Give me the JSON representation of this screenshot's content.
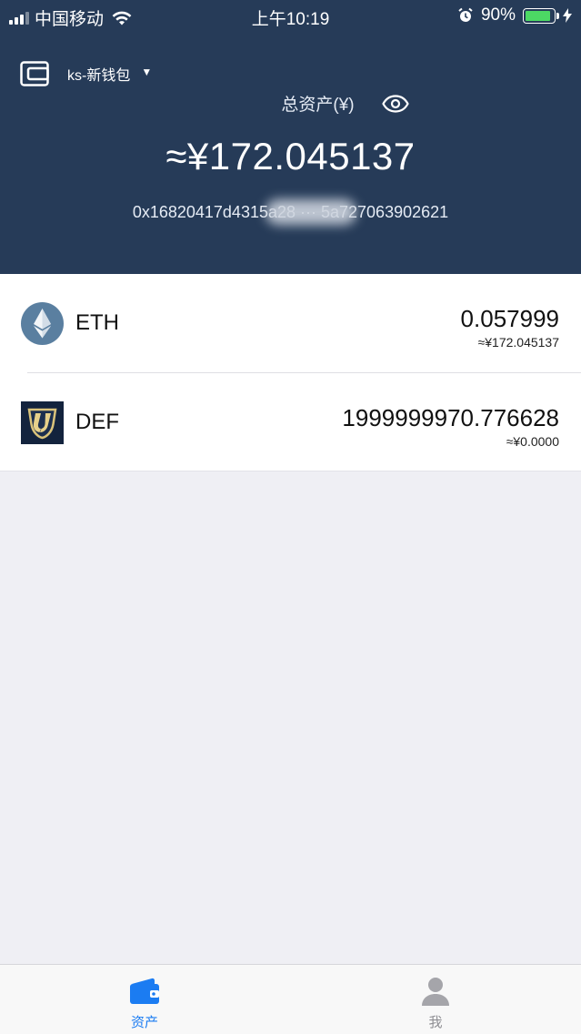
{
  "status_bar": {
    "carrier": "中国移动",
    "time": "上午10:19",
    "battery": "90%",
    "battery_level": 0.9
  },
  "header": {
    "wallet_name": "ks-新钱包",
    "total_label": "总资产(¥)",
    "total_value": "≈¥172.045137",
    "address": "0x16820417d4315a28 ··· 5a727063902621"
  },
  "tokens": [
    {
      "symbol": "ETH",
      "balance": "0.057999",
      "fiat": "≈¥172.045137",
      "icon": "ethereum-icon"
    },
    {
      "symbol": "DEF",
      "balance": "1999999970.776628",
      "fiat": "≈¥0.0000",
      "icon": "def-token-icon"
    }
  ],
  "tabbar": {
    "assets_label": "资产",
    "me_label": "我"
  },
  "colors": {
    "header_bg": "#263b58",
    "accent": "#1b7cf2",
    "page_bg": "#efeff4"
  }
}
